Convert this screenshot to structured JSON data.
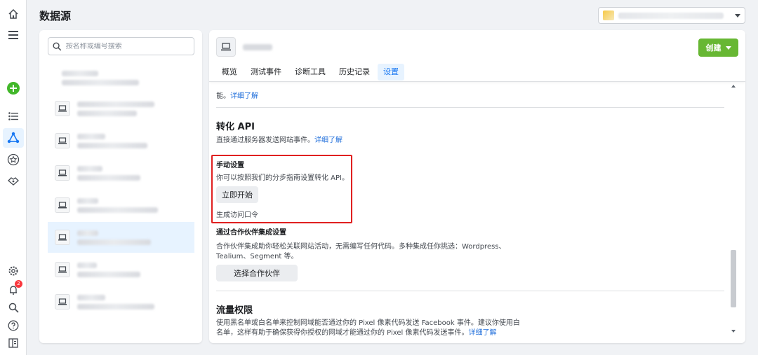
{
  "header": {
    "title": "数据源"
  },
  "colors": {
    "accent": "#1877f2",
    "create_button": "#67b733",
    "highlight": "#e02020",
    "badge": "#fa383e"
  },
  "rail": {
    "icons": [
      "home-icon",
      "menu-icon",
      "add-icon",
      "list-icon",
      "data-sources-icon",
      "star-icon",
      "integrations-icon",
      "settings-icon",
      "bell-icon",
      "search-icon",
      "help-icon",
      "panel-icon"
    ],
    "notification_count": "2"
  },
  "search": {
    "placeholder": "按名称或编号搜索"
  },
  "pixel": {
    "create_label": "创建",
    "tabs": [
      {
        "label": "概览"
      },
      {
        "label": "测试事件"
      },
      {
        "label": "诊断工具"
      },
      {
        "label": "历史记录"
      },
      {
        "label": "设置"
      }
    ],
    "active_tab": "设置"
  },
  "settings": {
    "top_text_line2": "能。",
    "learn_more": "详细了解",
    "conversions_api": {
      "title": "转化 API",
      "desc": "直接通过服务器发送网站事件。",
      "learn_more": "详细了解"
    },
    "manual_setup": {
      "title": "手动设置",
      "desc": "你可以按照我们的分步指南设置转化 API。",
      "start_button": "立即开始",
      "token_link": "生成访问口令"
    },
    "partner_setup": {
      "title": "通过合作伙伴集成设置",
      "desc_line1": "合作伙伴集成助你轻松关联网站活动，无需编写任何代码。多种集成任你挑选：Wordpress、",
      "desc_line2": "Tealium、Segment 等。",
      "select_button": "选择合作伙伴"
    },
    "traffic_permissions": {
      "title": "流量权限",
      "desc_line1": "使用黑名单或白名单来控制网域能否通过你的 Pixel 像素代码发送 Facebook 事件。建议你使用白",
      "desc_line2": "名单，这样有助于确保获得你授权的网域才能通过你的 Pixel 像素代码发送事件。",
      "learn_more": "详细了解"
    }
  }
}
